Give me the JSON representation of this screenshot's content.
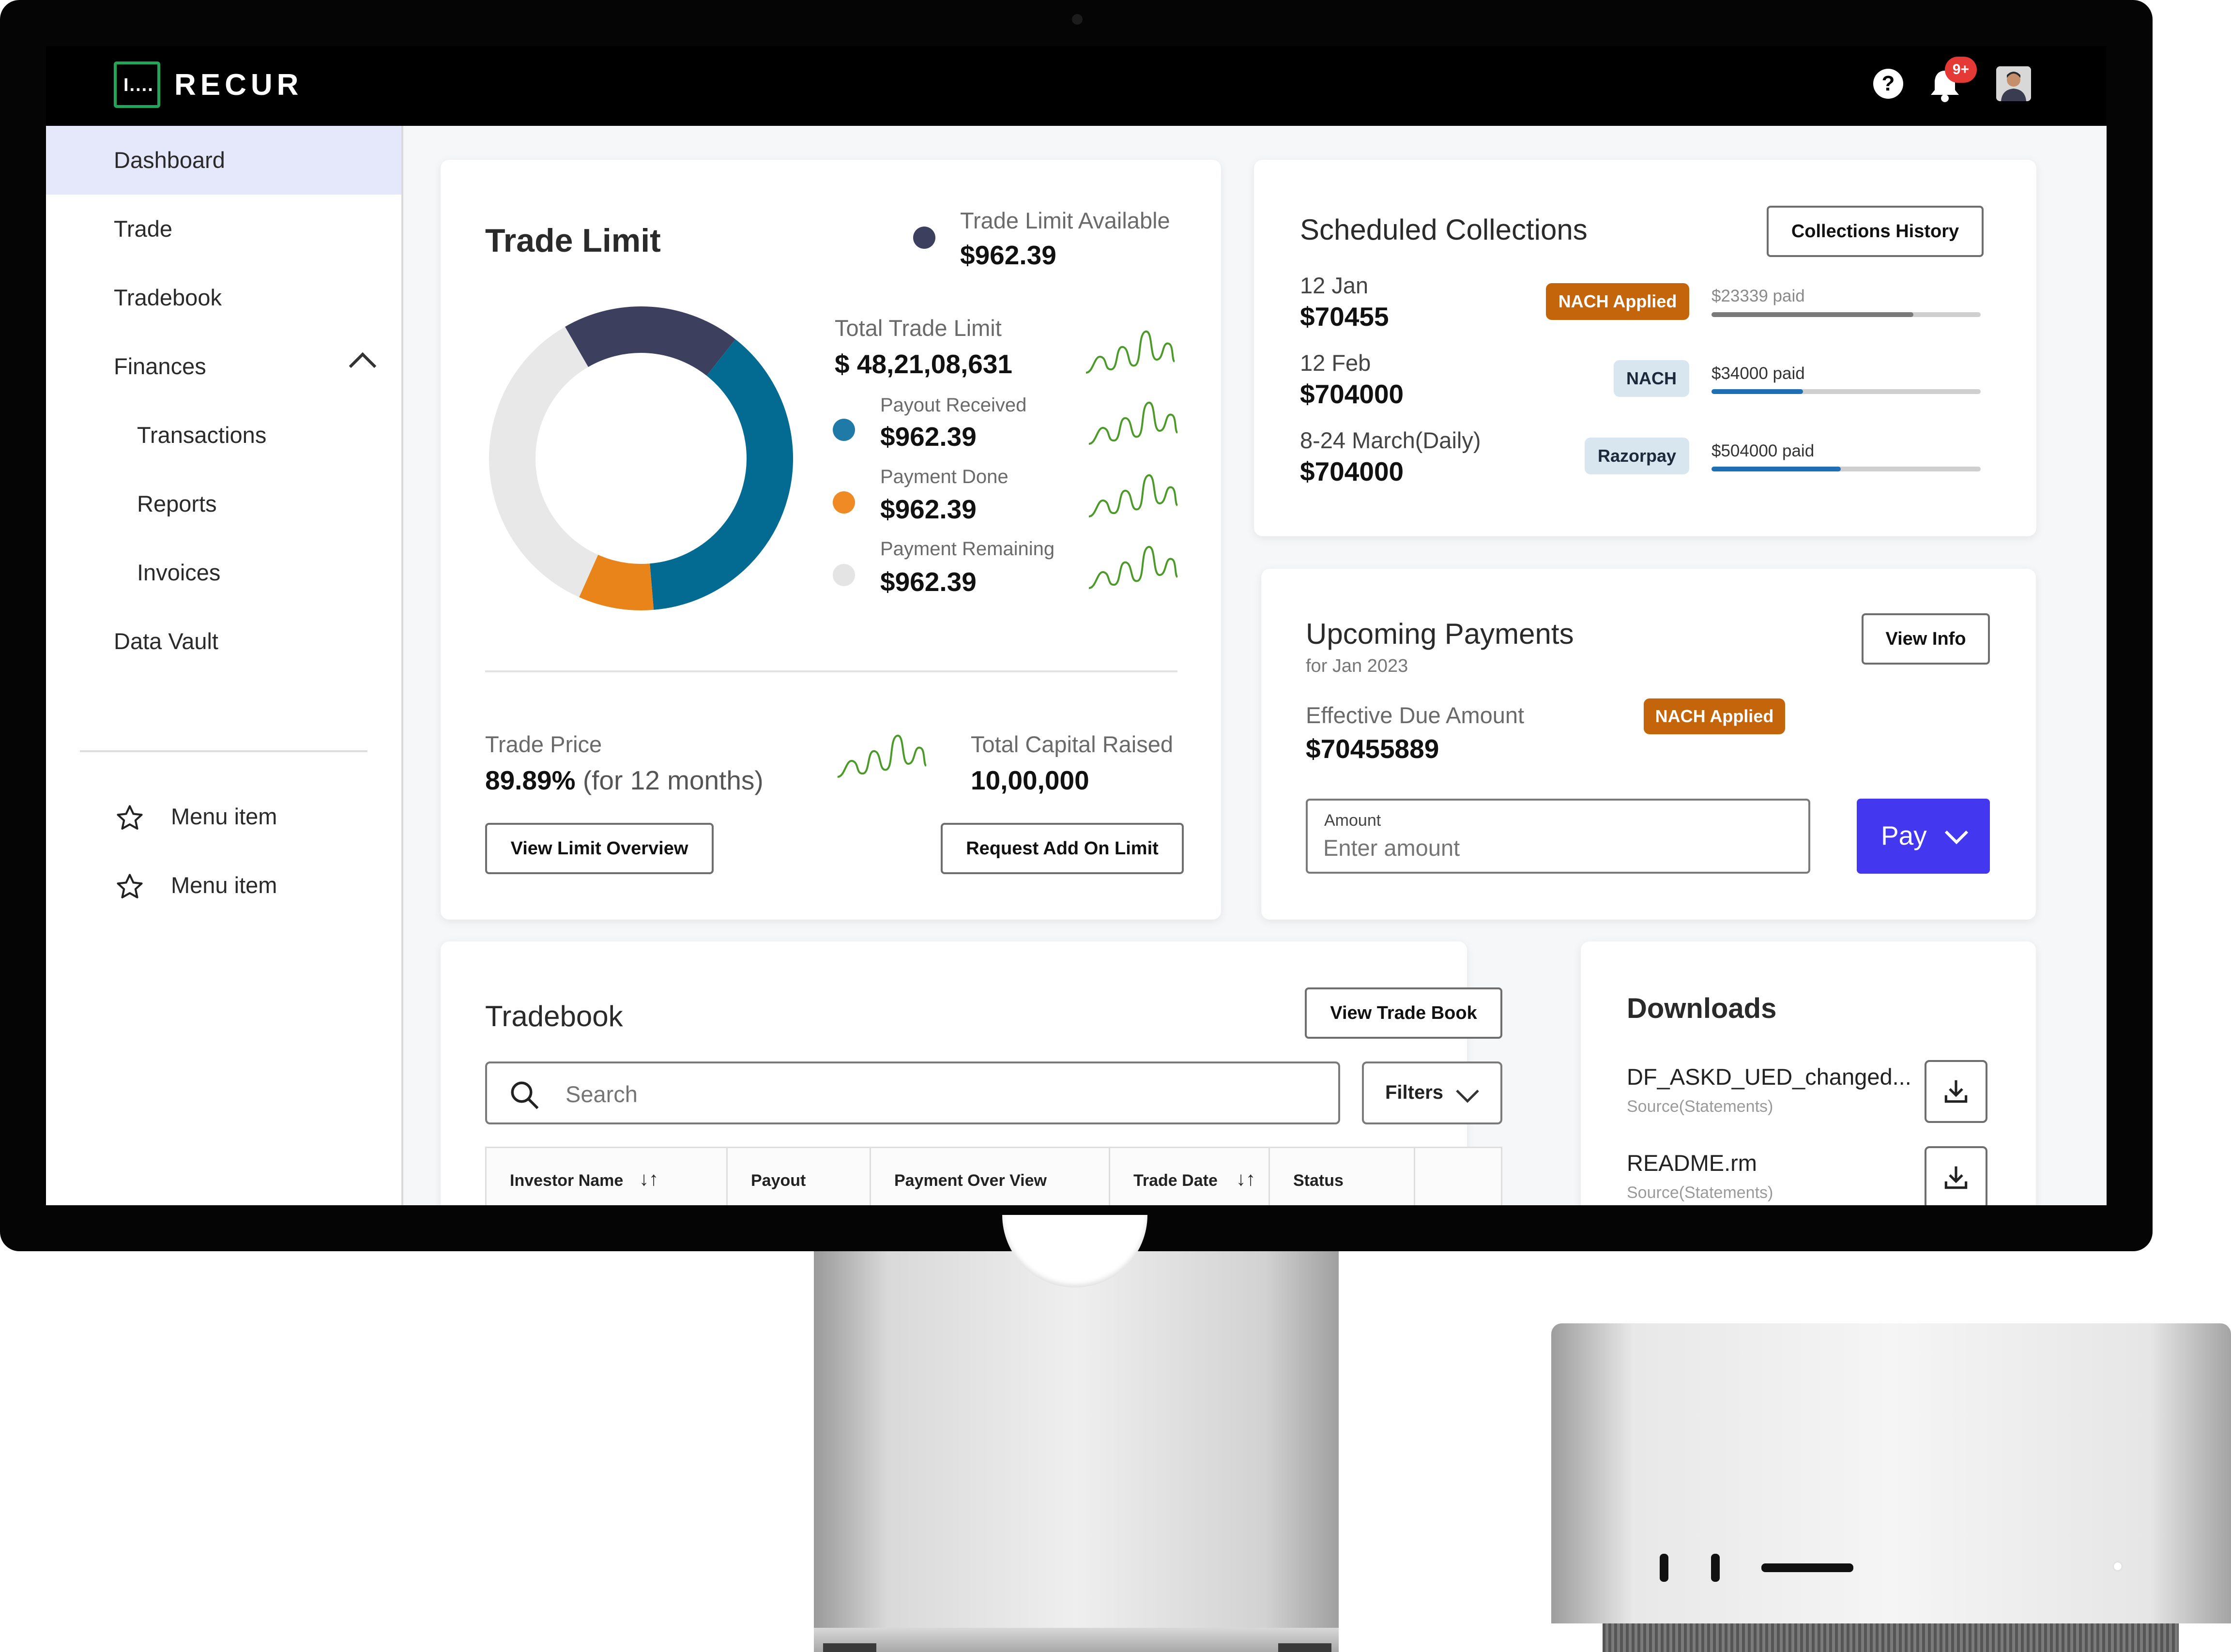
{
  "app": {
    "brand": "RECUR",
    "logo_glyph": "I....",
    "help_glyph": "?",
    "notifications_badge": "9+"
  },
  "colors": {
    "accent": "#4338f0",
    "brand_green": "#22a559",
    "donut_navy": "#3c3f5e",
    "donut_blue": "#036b91",
    "donut_orange": "#e8841a",
    "donut_grey": "#e8e8e8",
    "badge_orange": "#c4650c",
    "badge_blue_bg": "#d8e6f0",
    "spark_green": "#4c9a2a"
  },
  "sidebar": {
    "items": [
      {
        "label": "Dashboard",
        "active": true
      },
      {
        "label": "Trade"
      },
      {
        "label": "Tradebook"
      },
      {
        "label": "Finances",
        "expanded": true
      },
      {
        "label": "Transactions"
      },
      {
        "label": "Reports"
      },
      {
        "label": "Invoices"
      },
      {
        "label": "Data Vault"
      }
    ],
    "menu_items": [
      {
        "label": "Menu item",
        "icon": "star-icon"
      },
      {
        "label": "Menu item",
        "icon": "star-icon"
      }
    ]
  },
  "trade_limit": {
    "title": "Trade Limit",
    "available_label": "Trade Limit Available",
    "available_value": "$962.39",
    "total_label": "Total Trade Limit",
    "total_value": "$ 48,21,08,631",
    "legend": [
      {
        "label": "Payout Received",
        "value": "$962.39",
        "color": "#1f7aa8"
      },
      {
        "label": "Payment Done",
        "value": "$962.39",
        "color": "#f08a24"
      },
      {
        "label": "Payment Remaining",
        "value": "$962.39",
        "color": "#e4e4e4"
      }
    ],
    "donut_fractions": {
      "navy": 0.19,
      "blue": 0.38,
      "orange": 0.08,
      "grey": 0.35
    },
    "trade_price_label": "Trade Price",
    "trade_price_value": "89.89%",
    "trade_price_suffix": "(for 12 months)",
    "capital_label": "Total Capital Raised",
    "capital_value": "10,00,000",
    "view_button": "View Limit Overview",
    "request_button": "Request Add On Limit"
  },
  "collections": {
    "title": "Scheduled Collections",
    "history_button": "Collections History",
    "rows": [
      {
        "date": "12 Jan",
        "amount": "$70455",
        "badge": "NACH Applied",
        "badge_style": "orange",
        "paid": "$23339 paid",
        "progress": 0.75,
        "fill": "#7a7a7a"
      },
      {
        "date": "12 Feb",
        "amount": "$704000",
        "badge": "NACH",
        "badge_style": "blue",
        "paid": "$34000 paid",
        "progress": 0.34,
        "fill": "#1f6fb5"
      },
      {
        "date": "8-24 March(Daily)",
        "amount": "$704000",
        "badge": "Razorpay",
        "badge_style": "blue",
        "paid": "$504000 paid",
        "progress": 0.48,
        "fill": "#1f6fb5"
      }
    ]
  },
  "upcoming": {
    "title": "Upcoming Payments",
    "subtitle": "for Jan 2023",
    "view_button": "View Info",
    "due_label": "Effective Due Amount",
    "due_badge": "NACH Applied",
    "due_value": "$70455889",
    "amount_label": "Amount",
    "amount_placeholder": "Enter amount",
    "pay_button": "Pay"
  },
  "tradebook": {
    "title": "Tradebook",
    "view_button": "View Trade Book",
    "search_placeholder": "Search",
    "filters_label": "Filters",
    "columns": [
      "Investor Name",
      "Payout",
      "Payment Over View",
      "Trade Date",
      "Status"
    ]
  },
  "downloads": {
    "title": "Downloads",
    "files": [
      {
        "name": "DF_ASKD_UED_changed...",
        "source": "Source(Statements)"
      },
      {
        "name": "README.rm",
        "source": "Source(Statements)"
      }
    ]
  }
}
